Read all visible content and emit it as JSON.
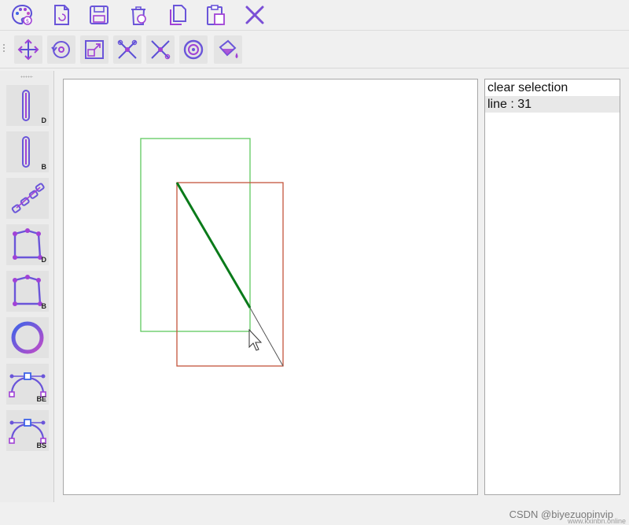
{
  "colors": {
    "accent_blue": "#3e63e8",
    "accent_purple": "#a142d6",
    "green_rect": "#5fc95f",
    "red_rect": "#c2553c",
    "selected_line": "#0a7a1a",
    "preview_line": "#555555"
  },
  "toolbar": {
    "top": [
      {
        "name": "palette-icon",
        "tooltip": ""
      },
      {
        "name": "new-file-icon",
        "tooltip": ""
      },
      {
        "name": "save-icon",
        "tooltip": ""
      },
      {
        "name": "trash-icon",
        "tooltip": ""
      },
      {
        "name": "copy-icon",
        "tooltip": ""
      },
      {
        "name": "paste-icon",
        "tooltip": ""
      },
      {
        "name": "close-icon",
        "tooltip": ""
      }
    ],
    "second": [
      {
        "name": "move-icon"
      },
      {
        "name": "rotate-icon"
      },
      {
        "name": "scale-icon"
      },
      {
        "name": "clip-icon"
      },
      {
        "name": "clip-alt-icon"
      },
      {
        "name": "circle-target-icon"
      },
      {
        "name": "fill-bucket-icon"
      }
    ]
  },
  "tools": [
    {
      "name": "line-dda-tool",
      "icon": "line-icon",
      "badge": "D"
    },
    {
      "name": "line-bresenham-tool",
      "icon": "line-icon",
      "badge": "B"
    },
    {
      "name": "polyline-tool",
      "icon": "polyline-icon",
      "badge": ""
    },
    {
      "name": "polygon-dda-tool",
      "icon": "polygon-icon",
      "badge": "D"
    },
    {
      "name": "polygon-bresenham-tool",
      "icon": "polygon-icon",
      "badge": "B"
    },
    {
      "name": "ellipse-tool",
      "icon": "ellipse-icon",
      "badge": ""
    },
    {
      "name": "curve-bezier-tool",
      "icon": "curve-icon",
      "badge": "BE"
    },
    {
      "name": "curve-bspline-tool",
      "icon": "curve-icon",
      "badge": "BS"
    }
  ],
  "side_panel": {
    "items": [
      {
        "label": "clear selection",
        "selected": false
      },
      {
        "label": "line : 31",
        "selected": true
      }
    ]
  },
  "watermark": {
    "main": "CSDN @biyezuopinvip",
    "small": "www.kxinbn.online"
  }
}
